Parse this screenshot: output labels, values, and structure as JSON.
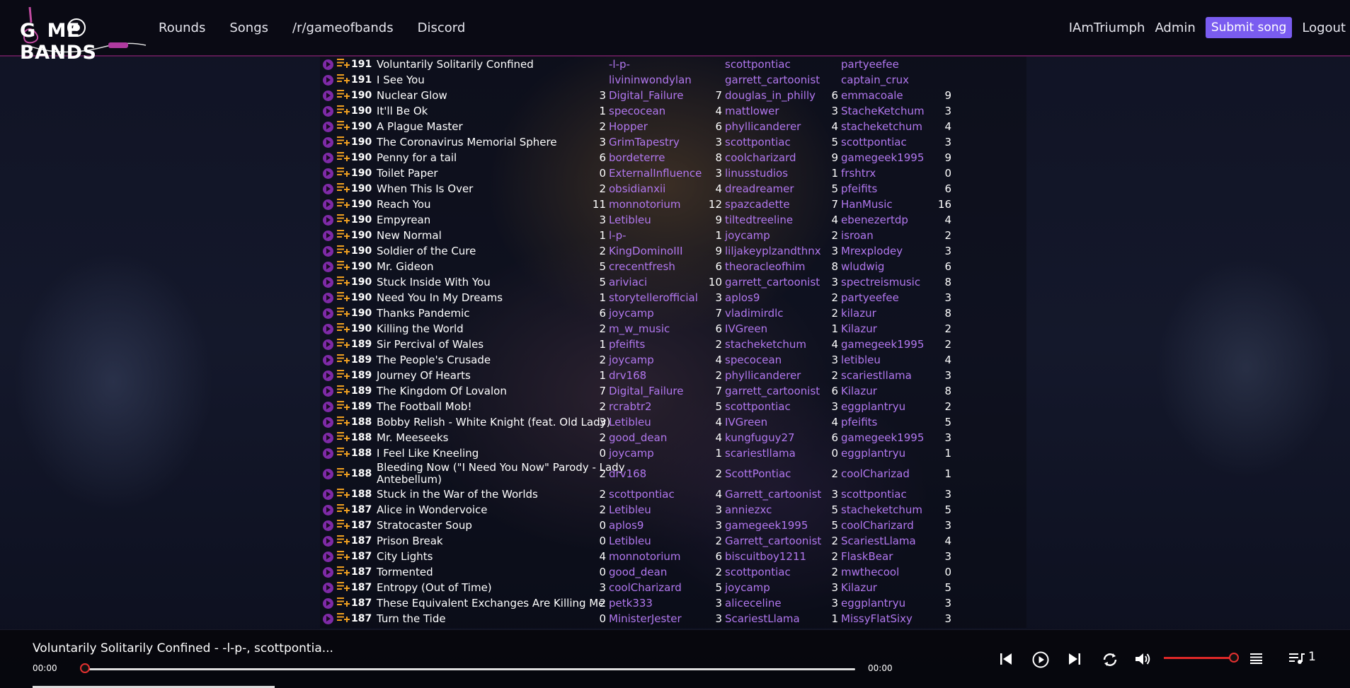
{
  "nav": {
    "logo_text": "GAMEOFBANDS",
    "links": [
      "Rounds",
      "Songs",
      "/r/gameofbands",
      "Discord"
    ],
    "user": "IAmTriumph",
    "admin": "Admin",
    "submit": "Submit song",
    "logout": "Logout"
  },
  "songs": [
    {
      "round": "191",
      "title": "Voluntarily Solitarily Confined",
      "s1": "",
      "music": "-l-p-",
      "s2": "",
      "lyrics": "scottpontiac",
      "s3": "",
      "vocals": "partyeefee",
      "s4": ""
    },
    {
      "round": "191",
      "title": "I See You",
      "s1": "",
      "music": "livininwondylan",
      "s2": "",
      "lyrics": "garrett_cartoonist",
      "s3": "",
      "vocals": "captain_crux",
      "s4": ""
    },
    {
      "round": "190",
      "title": "Nuclear Glow",
      "s1": "3",
      "music": "Digital_Failure",
      "s2": "7",
      "lyrics": "douglas_in_philly",
      "s3": "6",
      "vocals": "emmacoale",
      "s4": "9"
    },
    {
      "round": "190",
      "title": "It'll Be Ok",
      "s1": "1",
      "music": "specocean",
      "s2": "4",
      "lyrics": "mattlower",
      "s3": "3",
      "vocals": "StacheKetchum",
      "s4": "3"
    },
    {
      "round": "190",
      "title": "A Plague Master",
      "s1": "2",
      "music": "Hopper",
      "s2": "6",
      "lyrics": "phyllicanderer",
      "s3": "4",
      "vocals": "stacheketchum",
      "s4": "4"
    },
    {
      "round": "190",
      "title": "The Coronavirus Memorial Sphere",
      "s1": "3",
      "music": "GrimTapestry",
      "s2": "3",
      "lyrics": "scottpontiac",
      "s3": "5",
      "vocals": "scottpontiac",
      "s4": "3"
    },
    {
      "round": "190",
      "title": "Penny for a tail",
      "s1": "6",
      "music": "bordeterre",
      "s2": "8",
      "lyrics": "coolcharizard",
      "s3": "9",
      "vocals": "gamegeek1995",
      "s4": "9"
    },
    {
      "round": "190",
      "title": "Toilet Paper",
      "s1": "0",
      "music": "ExternalInfluence",
      "s2": "3",
      "lyrics": "linusstudios",
      "s3": "1",
      "vocals": "frshtrx",
      "s4": "0"
    },
    {
      "round": "190",
      "title": "When This Is Over",
      "s1": "2",
      "music": "obsidianxii",
      "s2": "4",
      "lyrics": "dreadreamer",
      "s3": "5",
      "vocals": "pfeifits",
      "s4": "6"
    },
    {
      "round": "190",
      "title": "Reach You",
      "s1": "11",
      "music": "monnotorium",
      "s2": "12",
      "lyrics": "spazcadette",
      "s3": "7",
      "vocals": "HanMusic",
      "s4": "16"
    },
    {
      "round": "190",
      "title": "Empyrean",
      "s1": "3",
      "music": "Letibleu",
      "s2": "9",
      "lyrics": "tiltedtreeline",
      "s3": "4",
      "vocals": "ebenezertdp",
      "s4": "4"
    },
    {
      "round": "190",
      "title": "New Normal",
      "s1": "1",
      "music": "l-p-",
      "s2": "1",
      "lyrics": "joycamp",
      "s3": "2",
      "vocals": "isroan",
      "s4": "2"
    },
    {
      "round": "190",
      "title": "Soldier of the Cure",
      "s1": "2",
      "music": "KingDominoIII",
      "s2": "9",
      "lyrics": "liljakeyplzandthnx",
      "s3": "3",
      "vocals": "Mrexplodey",
      "s4": "3"
    },
    {
      "round": "190",
      "title": "Mr. Gideon",
      "s1": "5",
      "music": "crecentfresh",
      "s2": "6",
      "lyrics": "theoracleofhim",
      "s3": "8",
      "vocals": "wludwig",
      "s4": "6"
    },
    {
      "round": "190",
      "title": "Stuck Inside With You",
      "s1": "5",
      "music": "ariviaci",
      "s2": "10",
      "lyrics": "garrett_cartoonist",
      "s3": "3",
      "vocals": "spectreismusic",
      "s4": "8"
    },
    {
      "round": "190",
      "title": "Need You In My Dreams",
      "s1": "1",
      "music": "storytellerofficial",
      "s2": "3",
      "lyrics": "aplos9",
      "s3": "2",
      "vocals": "partyeefee",
      "s4": "3"
    },
    {
      "round": "190",
      "title": "Thanks Pandemic",
      "s1": "6",
      "music": "joycamp",
      "s2": "7",
      "lyrics": "vladimirdlc",
      "s3": "2",
      "vocals": "kilazur",
      "s4": "8"
    },
    {
      "round": "190",
      "title": "Killing the World",
      "s1": "2",
      "music": "m_w_music",
      "s2": "6",
      "lyrics": "IVGreen",
      "s3": "1",
      "vocals": "Kilazur",
      "s4": "2"
    },
    {
      "round": "189",
      "title": "Sir Percival of Wales",
      "s1": "1",
      "music": "pfeifits",
      "s2": "2",
      "lyrics": "stacheketchum",
      "s3": "4",
      "vocals": "gamegeek1995",
      "s4": "2"
    },
    {
      "round": "189",
      "title": "The People's Crusade",
      "s1": "2",
      "music": "joycamp",
      "s2": "4",
      "lyrics": "specocean",
      "s3": "3",
      "vocals": "letibleu",
      "s4": "4"
    },
    {
      "round": "189",
      "title": "Journey Of Hearts",
      "s1": "1",
      "music": "drv168",
      "s2": "2",
      "lyrics": "phyllicanderer",
      "s3": "2",
      "vocals": "scariestllama",
      "s4": "3"
    },
    {
      "round": "189",
      "title": "The Kingdom Of Lovalon",
      "s1": "7",
      "music": "Digital_Failure",
      "s2": "7",
      "lyrics": "garrett_cartoonist",
      "s3": "6",
      "vocals": "Kilazur",
      "s4": "8"
    },
    {
      "round": "189",
      "title": "The Football Mob!",
      "s1": "2",
      "music": "rcrabtr2",
      "s2": "5",
      "lyrics": "scottpontiac",
      "s3": "3",
      "vocals": "eggplantryu",
      "s4": "2"
    },
    {
      "round": "188",
      "title": "Bobby Relish - White Knight (feat. Old Lady)",
      "s1": "3",
      "music": "Letibleu",
      "s2": "4",
      "lyrics": "IVGreen",
      "s3": "4",
      "vocals": "pfeifits",
      "s4": "5"
    },
    {
      "round": "188",
      "title": "Mr. Meeseeks",
      "s1": "2",
      "music": "good_dean",
      "s2": "4",
      "lyrics": "kungfuguy27",
      "s3": "6",
      "vocals": "gamegeek1995",
      "s4": "3"
    },
    {
      "round": "188",
      "title": "I Feel Like Kneeling",
      "s1": "0",
      "music": "joycamp",
      "s2": "1",
      "lyrics": "scariestllama",
      "s3": "0",
      "vocals": "eggplantryu",
      "s4": "1"
    },
    {
      "round": "188",
      "title": "Bleeding Now (\"I Need You Now\" Parody - Lady Antebellum)",
      "s1": "2",
      "music": "drv168",
      "s2": "2",
      "lyrics": "ScottPontiac",
      "s3": "2",
      "vocals": "coolCharizad",
      "s4": "1",
      "tall": true
    },
    {
      "round": "188",
      "title": "Stuck in the War of the Worlds",
      "s1": "2",
      "music": "scottpontiac",
      "s2": "4",
      "lyrics": "Garrett_cartoonist",
      "s3": "3",
      "vocals": "scottpontiac",
      "s4": "3"
    },
    {
      "round": "187",
      "title": "Alice in Wondervoice",
      "s1": "2",
      "music": "Letibleu",
      "s2": "3",
      "lyrics": "anniezxc",
      "s3": "5",
      "vocals": "stacheketchum",
      "s4": "5"
    },
    {
      "round": "187",
      "title": "Stratocaster Soup",
      "s1": "0",
      "music": "aplos9",
      "s2": "3",
      "lyrics": "gamegeek1995",
      "s3": "5",
      "vocals": "coolCharizard",
      "s4": "3"
    },
    {
      "round": "187",
      "title": "Prison Break",
      "s1": "0",
      "music": "Letibleu",
      "s2": "2",
      "lyrics": "Garrett_cartoonist",
      "s3": "2",
      "vocals": "ScariestLlama",
      "s4": "4"
    },
    {
      "round": "187",
      "title": "City Lights",
      "s1": "4",
      "music": "monnotorium",
      "s2": "6",
      "lyrics": "biscuitboy1211",
      "s3": "2",
      "vocals": "FlaskBear",
      "s4": "3"
    },
    {
      "round": "187",
      "title": "Tormented",
      "s1": "0",
      "music": "good_dean",
      "s2": "2",
      "lyrics": "scottpontiac",
      "s3": "2",
      "vocals": "mwthecool",
      "s4": "0"
    },
    {
      "round": "187",
      "title": "Entropy (Out of Time)",
      "s1": "3",
      "music": "coolCharizard",
      "s2": "5",
      "lyrics": "joycamp",
      "s3": "3",
      "vocals": "Kilazur",
      "s4": "5"
    },
    {
      "round": "187",
      "title": "These Equivalent Exchanges Are Killing Me",
      "s1": "2",
      "music": "petk333",
      "s2": "3",
      "lyrics": "aliceceline",
      "s3": "3",
      "vocals": "eggplantryu",
      "s4": "3"
    },
    {
      "round": "187",
      "title": "Turn the Tide",
      "s1": "0",
      "music": "MinisterJester",
      "s2": "3",
      "lyrics": "ScariestLlama",
      "s3": "1",
      "vocals": "MissyFlatSixy",
      "s4": "3"
    }
  ],
  "player": {
    "now_playing": "Voluntarily Solitarily Confined - -l-p-, scottpontia...",
    "current_time": "00:00",
    "total_time": "00:00",
    "progress": 0,
    "volume": 0.92,
    "queue_count": "1"
  }
}
